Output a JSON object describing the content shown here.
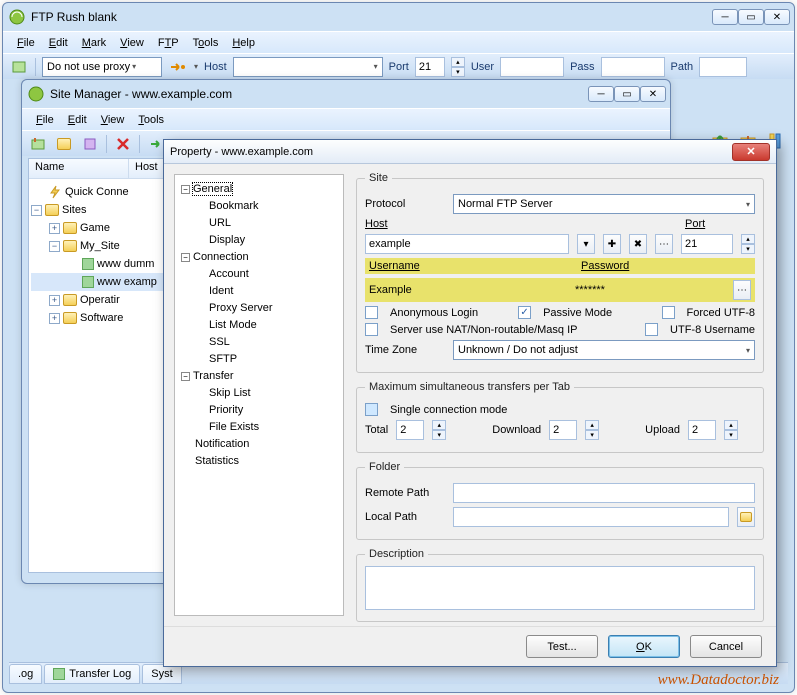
{
  "app": {
    "title": "FTP Rush   blank"
  },
  "mainmenu": {
    "file": "File",
    "edit": "Edit",
    "mark": "Mark",
    "view": "View",
    "ftp": "FTP",
    "tools": "Tools",
    "help": "Help"
  },
  "proxybar": {
    "proxylabel": "Do not use proxy",
    "host": "Host",
    "host_val": "",
    "port": "Port",
    "port_val": "21",
    "user": "User",
    "user_val": "",
    "pass": "Pass",
    "pass_val": "",
    "path": "Path",
    "path_val": ""
  },
  "tabs": {
    "log": ".og",
    "transfer": "Transfer Log",
    "syst": "Syst"
  },
  "site_manager": {
    "title": "Site Manager  - www.example.com",
    "menu": {
      "file": "File",
      "edit": "Edit",
      "view": "View",
      "tools": "Tools"
    },
    "cols": {
      "name": "Name",
      "host": "Host"
    },
    "tree": {
      "quick": "Quick Conne",
      "sites": "Sites",
      "game": "Game",
      "mysites": "My_Site",
      "dummy": "www dumm",
      "example": "www examp",
      "operatir": "Operatir",
      "software": "Software"
    }
  },
  "property": {
    "title": "Property - www.example.com",
    "nav": {
      "general": "General",
      "bookmark": "Bookmark",
      "url": "URL",
      "display": "Display",
      "connection": "Connection",
      "account": "Account",
      "ident": "Ident",
      "proxy": "Proxy Server",
      "listmode": "List Mode",
      "ssl": "SSL",
      "sftp": "SFTP",
      "transfer": "Transfer",
      "skip": "Skip List",
      "priority": "Priority",
      "fileexists": "File Exists",
      "notification": "Notification",
      "statistics": "Statistics"
    },
    "site": {
      "legend": "Site",
      "protocol": "Protocol",
      "protocol_val": "Normal FTP Server",
      "host": "Host",
      "host_val": "example",
      "port": "Port",
      "port_val": "21",
      "user": "Username",
      "user_val": "Example",
      "pass": "Password",
      "pass_val": "*******",
      "anon": "Anonymous Login",
      "pasv": "Passive Mode",
      "forced": "Forced UTF-8",
      "nat": "Server use NAT/Non-routable/Masq IP",
      "utf8user": "UTF-8 Username",
      "tz": "Time Zone",
      "tz_val": "Unknown / Do not adjust"
    },
    "transfers": {
      "legend": "Maximum simultaneous transfers per Tab",
      "single": "Single connection mode",
      "total": "Total",
      "total_v": "2",
      "down": "Download",
      "down_v": "2",
      "up": "Upload",
      "up_v": "2"
    },
    "folder": {
      "legend": "Folder",
      "remote": "Remote Path",
      "local": "Local Path"
    },
    "desc": {
      "legend": "Description"
    },
    "buttons": {
      "test": "Test...",
      "ok": "OK",
      "cancel": "Cancel"
    }
  },
  "watermark": "www.Datadoctor.biz"
}
